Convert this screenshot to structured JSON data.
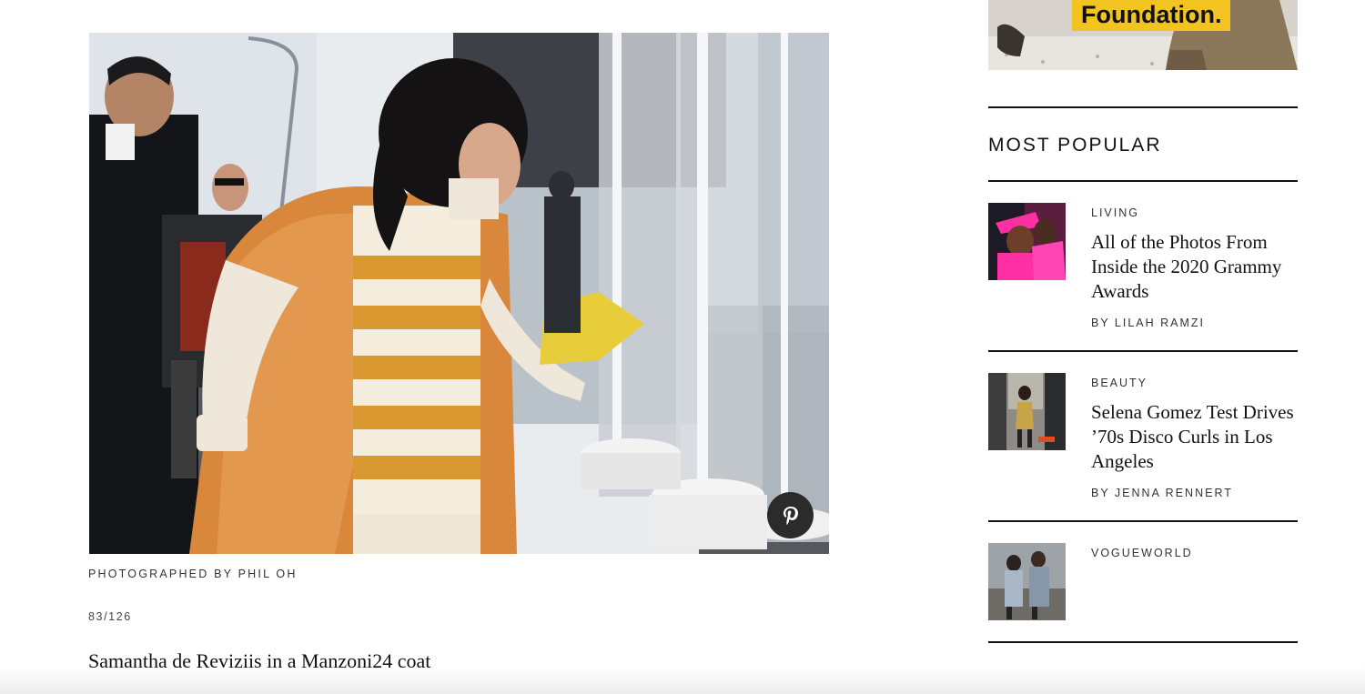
{
  "article": {
    "credit": "PHOTOGRAPHED BY PHIL OH",
    "counter": "83/126",
    "caption": "Samantha de Reviziis in a Manzoni24 coat"
  },
  "ad": {
    "text": "Foundation."
  },
  "sidebar": {
    "heading": "MOST POPULAR",
    "stories": [
      {
        "kicker": "LIVING",
        "headline": "All of the Photos From Inside the 2020 Grammy Awards",
        "byline": "BY LILAH RAMZI"
      },
      {
        "kicker": "BEAUTY",
        "headline": "Selena Gomez Test Drives ’70s Disco Curls in Los Angeles",
        "byline": "BY JENNA RENNERT"
      },
      {
        "kicker": "VOGUEWORLD",
        "headline": "",
        "byline": ""
      }
    ]
  },
  "icons": {
    "share": "pinterest-icon"
  },
  "colors": {
    "accent_yellow": "#f3c322",
    "coat_orange": "#d9873a",
    "pink": "#ff2fa4"
  }
}
